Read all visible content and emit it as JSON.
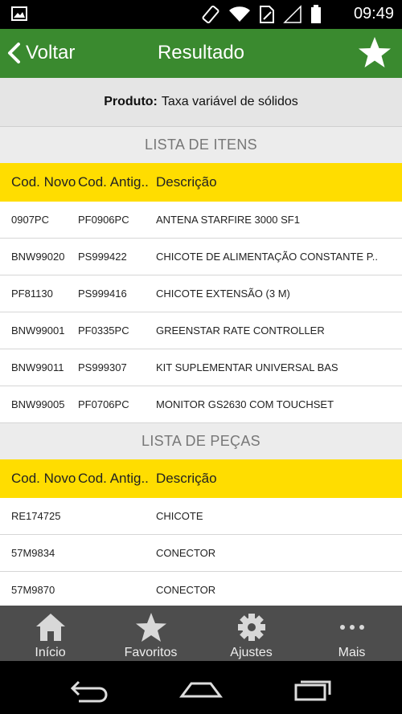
{
  "status_bar": {
    "time": "09:49",
    "icons": [
      "image-icon",
      "rotate-icon",
      "wifi-icon",
      "sim-icon",
      "signal-icon",
      "battery-icon"
    ]
  },
  "app_bar": {
    "back_label": "Voltar",
    "title": "Resultado",
    "favorite_icon": "star-icon"
  },
  "product": {
    "label": "Produto:",
    "value": "Taxa variável de sólidos"
  },
  "items_section": {
    "title": "LISTA DE ITENS",
    "headers": [
      "Cod. Novo",
      "Cod. Antig..",
      "Descrição"
    ],
    "rows": [
      [
        "0907PC",
        "PF0906PC",
        "ANTENA STARFIRE 3000 SF1"
      ],
      [
        "BNW99020",
        "PS999422",
        "CHICOTE DE ALIMENTAÇÃO CONSTANTE P.."
      ],
      [
        "PF81130",
        "PS999416",
        "CHICOTE EXTENSÃO (3 M)"
      ],
      [
        "BNW99001",
        "PF0335PC",
        "GREENSTAR RATE CONTROLLER"
      ],
      [
        "BNW99011",
        "PS999307",
        "KIT SUPLEMENTAR UNIVERSAL BAS"
      ],
      [
        "BNW99005",
        "PF0706PC",
        "MONITOR GS2630 COM TOUCHSET"
      ]
    ]
  },
  "parts_section": {
    "title": "LISTA DE PEÇAS",
    "headers": [
      "Cod. Novo",
      "Cod. Antig..",
      "Descrição"
    ],
    "rows": [
      [
        "RE174725",
        "",
        "CHICOTE"
      ],
      [
        "57M9834",
        "",
        "CONECTOR"
      ],
      [
        "57M9870",
        "",
        "CONECTOR"
      ]
    ]
  },
  "tab_bar": {
    "tabs": [
      {
        "label": "Início",
        "icon": "home-icon"
      },
      {
        "label": "Favoritos",
        "icon": "star-icon"
      },
      {
        "label": "Ajustes",
        "icon": "gear-icon"
      },
      {
        "label": "Mais",
        "icon": "more-icon"
      }
    ]
  },
  "colors": {
    "app_bar": "#3a8a2f",
    "table_header": "#ffdd00",
    "tab_bar": "#4d4d4d"
  }
}
